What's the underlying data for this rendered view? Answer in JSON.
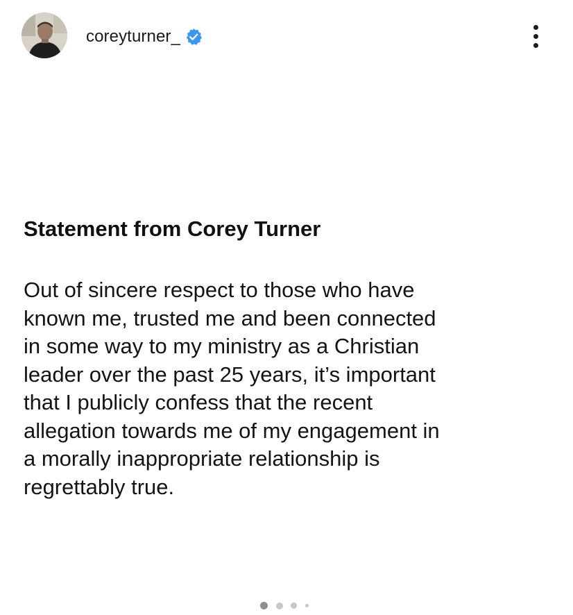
{
  "post": {
    "username": "coreyturner_",
    "verified": true,
    "avatar_icon": "profile-photo",
    "more_icon": "more-options-icon",
    "title": "Statement from Corey Turner",
    "body_lines": [
      "Out of sincere respect to those who have",
      "known me, trusted me and been connected",
      "in some way to my ministry as a Christian",
      "leader over the past 25 years, it’s important",
      "that I publicly confess that the recent",
      "allegation towards me of my engagement in",
      "a morally inappropriate relationship is",
      "regrettably true."
    ]
  },
  "carousel": {
    "total_visible_dots": 4,
    "active_index": 0
  },
  "colors": {
    "verified_blue": "#3897f0",
    "active_dot": "#8e8e8e",
    "inactive_dot": "#c7c7c7",
    "text": "#111111"
  }
}
